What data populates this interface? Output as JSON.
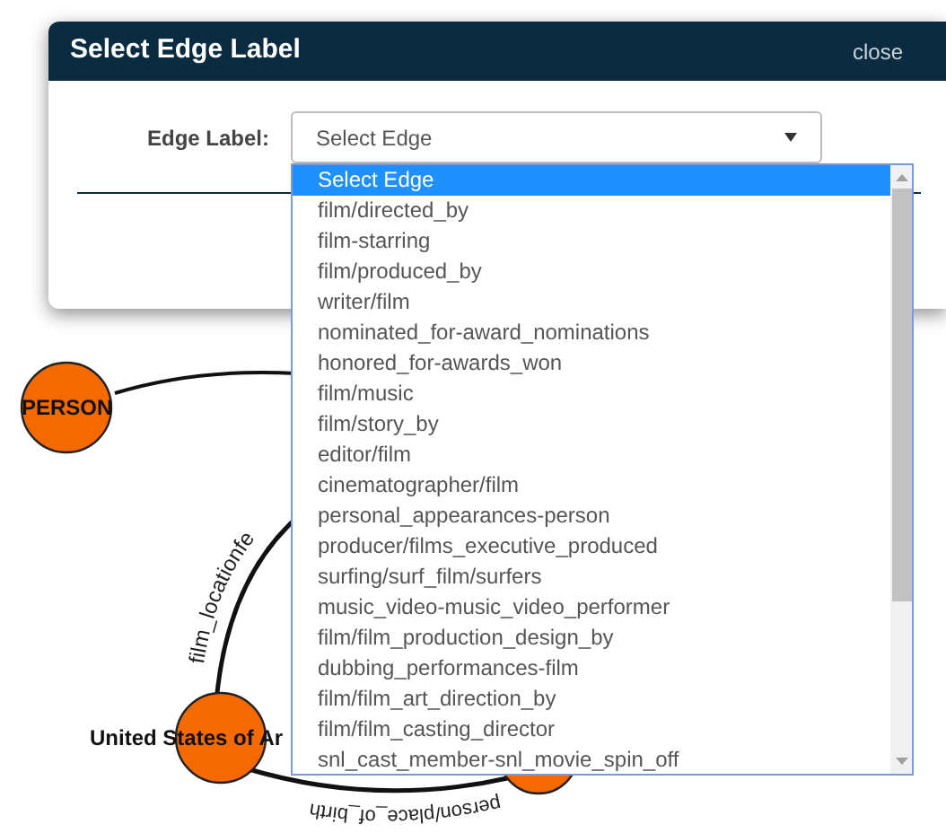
{
  "graph": {
    "nodes": [
      {
        "label": "PERSON"
      },
      {
        "label": "United States of Ar"
      }
    ],
    "edges": [
      {
        "label": "film_locationfe"
      },
      {
        "label": "person/place_of_birth"
      }
    ]
  },
  "dialog": {
    "title": "Select Edge Label",
    "close": "close",
    "field_label": "Edge Label:",
    "select": {
      "value": "Select Edge",
      "expanded": true,
      "options": [
        {
          "label": "Select Edge",
          "selected": true
        },
        {
          "label": "film/directed_by",
          "selected": false
        },
        {
          "label": "film-starring",
          "selected": false
        },
        {
          "label": "film/produced_by",
          "selected": false
        },
        {
          "label": "writer/film",
          "selected": false
        },
        {
          "label": "nominated_for-award_nominations",
          "selected": false
        },
        {
          "label": "honored_for-awards_won",
          "selected": false
        },
        {
          "label": "film/music",
          "selected": false
        },
        {
          "label": "film/story_by",
          "selected": false
        },
        {
          "label": "editor/film",
          "selected": false
        },
        {
          "label": "cinematographer/film",
          "selected": false
        },
        {
          "label": "personal_appearances-person",
          "selected": false
        },
        {
          "label": "producer/films_executive_produced",
          "selected": false
        },
        {
          "label": "surfing/surf_film/surfers",
          "selected": false
        },
        {
          "label": "music_video-music_video_performer",
          "selected": false
        },
        {
          "label": "film/film_production_design_by",
          "selected": false
        },
        {
          "label": "dubbing_performances-film",
          "selected": false
        },
        {
          "label": "film/film_art_direction_by",
          "selected": false
        },
        {
          "label": "film/film_casting_director",
          "selected": false
        },
        {
          "label": "snl_cast_member-snl_movie_spin_off",
          "selected": false
        }
      ]
    }
  }
}
